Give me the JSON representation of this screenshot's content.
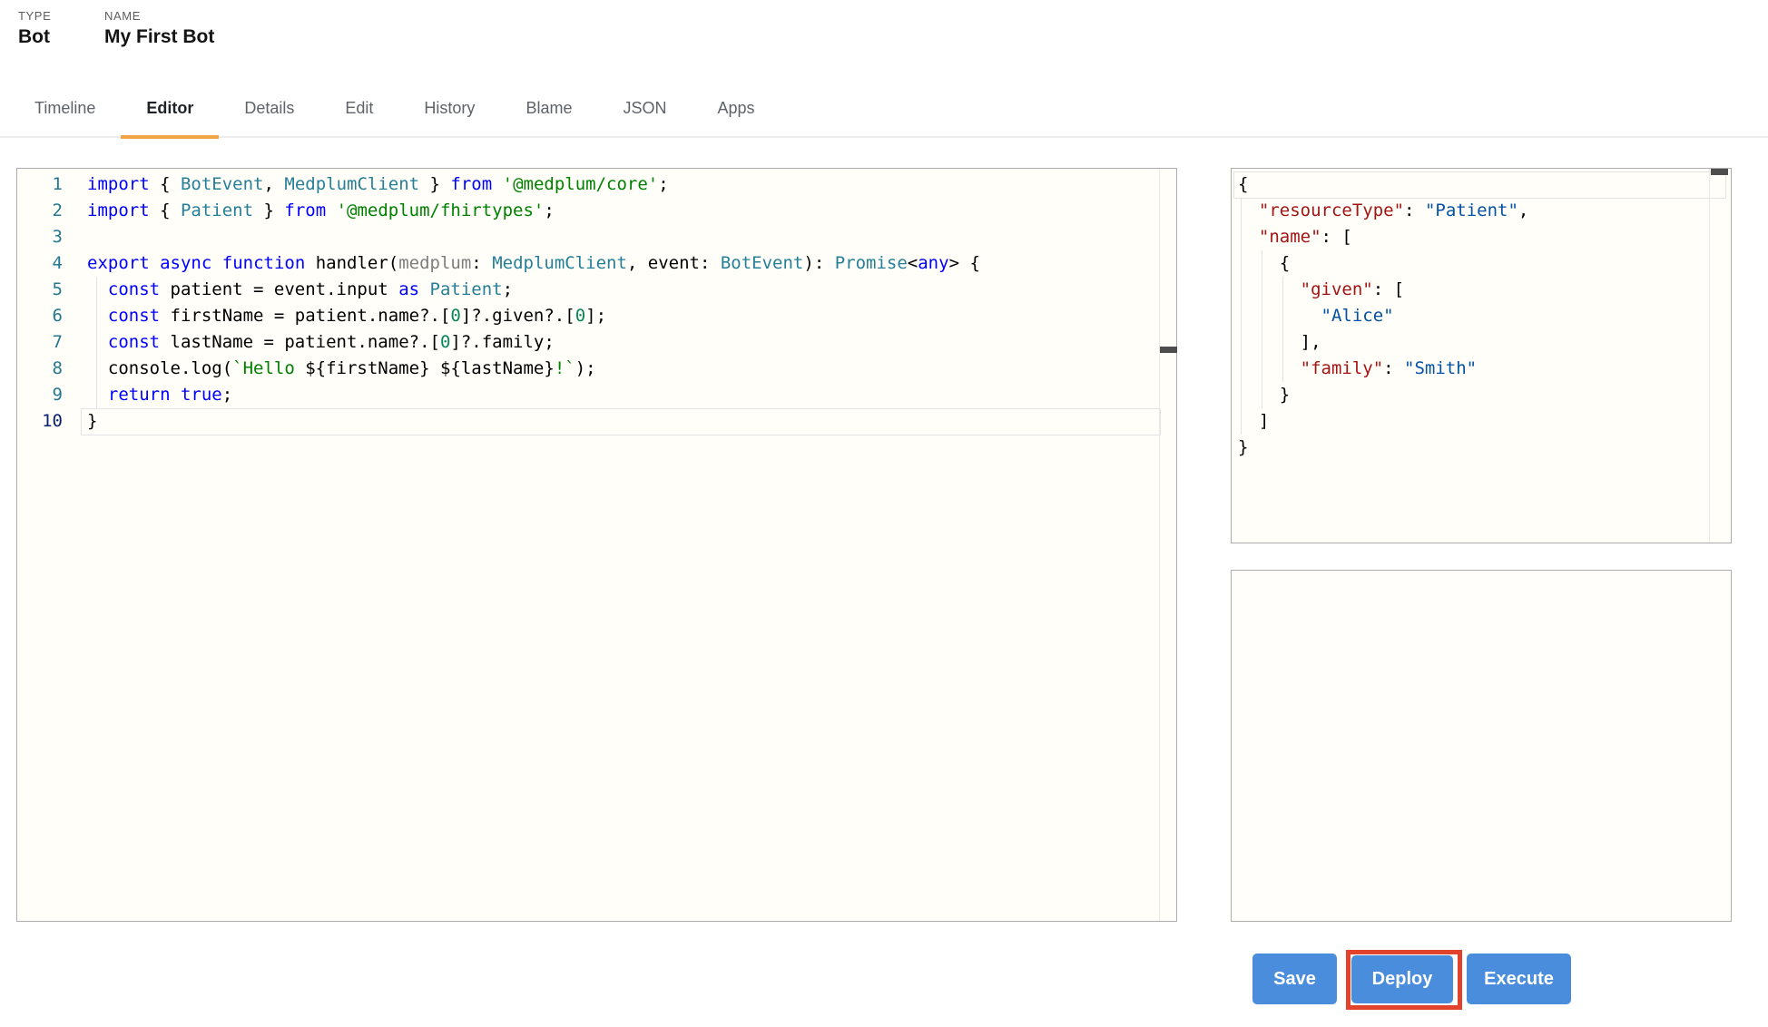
{
  "header": {
    "type_label": "TYPE",
    "type_value": "Bot",
    "name_label": "NAME",
    "name_value": "My First Bot"
  },
  "tabs": {
    "items": [
      "Timeline",
      "Editor",
      "Details",
      "Edit",
      "History",
      "Blame",
      "JSON",
      "Apps"
    ],
    "active": "Editor"
  },
  "colors": {
    "accent_orange": "#f2a444",
    "button_blue": "#4a8ddd",
    "annotation_red": "#e2432c",
    "line_number": "#237893",
    "active_line_number": "#0b216f",
    "panel_border": "#adadad"
  },
  "code_editor": {
    "active_line": 10,
    "lines": [
      {
        "num": 1,
        "tokens": [
          {
            "c": "kw",
            "t": "import"
          },
          {
            "c": "pl",
            "t": " { "
          },
          {
            "c": "ty",
            "t": "BotEvent"
          },
          {
            "c": "pl",
            "t": ", "
          },
          {
            "c": "ty",
            "t": "MedplumClient"
          },
          {
            "c": "pl",
            "t": " } "
          },
          {
            "c": "kw",
            "t": "from"
          },
          {
            "c": "pl",
            "t": " "
          },
          {
            "c": "st",
            "t": "'@medplum/core'"
          },
          {
            "c": "pl",
            "t": ";"
          }
        ]
      },
      {
        "num": 2,
        "tokens": [
          {
            "c": "kw",
            "t": "import"
          },
          {
            "c": "pl",
            "t": " { "
          },
          {
            "c": "ty",
            "t": "Patient"
          },
          {
            "c": "pl",
            "t": " } "
          },
          {
            "c": "kw",
            "t": "from"
          },
          {
            "c": "pl",
            "t": " "
          },
          {
            "c": "st",
            "t": "'@medplum/fhirtypes'"
          },
          {
            "c": "pl",
            "t": ";"
          }
        ]
      },
      {
        "num": 3,
        "tokens": []
      },
      {
        "num": 4,
        "tokens": [
          {
            "c": "kw",
            "t": "export"
          },
          {
            "c": "pl",
            "t": " "
          },
          {
            "c": "kw",
            "t": "async"
          },
          {
            "c": "pl",
            "t": " "
          },
          {
            "c": "kw",
            "t": "function"
          },
          {
            "c": "pl",
            "t": " handler("
          },
          {
            "c": "dim",
            "t": "medplum"
          },
          {
            "c": "pl",
            "t": ": "
          },
          {
            "c": "ty",
            "t": "MedplumClient"
          },
          {
            "c": "pl",
            "t": ", event: "
          },
          {
            "c": "ty",
            "t": "BotEvent"
          },
          {
            "c": "pl",
            "t": "): "
          },
          {
            "c": "ty",
            "t": "Promise"
          },
          {
            "c": "pl",
            "t": "<"
          },
          {
            "c": "kw",
            "t": "any"
          },
          {
            "c": "pl",
            "t": "> {"
          }
        ]
      },
      {
        "num": 5,
        "tokens": [
          {
            "c": "pl",
            "t": "  "
          },
          {
            "c": "kw",
            "t": "const"
          },
          {
            "c": "pl",
            "t": " patient = event.input "
          },
          {
            "c": "kw",
            "t": "as"
          },
          {
            "c": "pl",
            "t": " "
          },
          {
            "c": "ty",
            "t": "Patient"
          },
          {
            "c": "pl",
            "t": ";"
          }
        ]
      },
      {
        "num": 6,
        "tokens": [
          {
            "c": "pl",
            "t": "  "
          },
          {
            "c": "kw",
            "t": "const"
          },
          {
            "c": "pl",
            "t": " firstName = patient.name?.["
          },
          {
            "c": "nu",
            "t": "0"
          },
          {
            "c": "pl",
            "t": "]?.given?.["
          },
          {
            "c": "nu",
            "t": "0"
          },
          {
            "c": "pl",
            "t": "];"
          }
        ]
      },
      {
        "num": 7,
        "tokens": [
          {
            "c": "pl",
            "t": "  "
          },
          {
            "c": "kw",
            "t": "const"
          },
          {
            "c": "pl",
            "t": " lastName = patient.name?.["
          },
          {
            "c": "nu",
            "t": "0"
          },
          {
            "c": "pl",
            "t": "]?.family;"
          }
        ]
      },
      {
        "num": 8,
        "tokens": [
          {
            "c": "pl",
            "t": "  console.log("
          },
          {
            "c": "st",
            "t": "`Hello "
          },
          {
            "c": "pl",
            "t": "${firstName}"
          },
          {
            "c": "st",
            "t": " "
          },
          {
            "c": "pl",
            "t": "${lastName}"
          },
          {
            "c": "st",
            "t": "!`"
          },
          {
            "c": "pl",
            "t": ");"
          }
        ]
      },
      {
        "num": 9,
        "tokens": [
          {
            "c": "pl",
            "t": "  "
          },
          {
            "c": "kw",
            "t": "return"
          },
          {
            "c": "pl",
            "t": " "
          },
          {
            "c": "kw",
            "t": "true"
          },
          {
            "c": "pl",
            "t": ";"
          }
        ]
      },
      {
        "num": 10,
        "tokens": [
          {
            "c": "pl",
            "t": "}"
          }
        ]
      }
    ]
  },
  "input_editor": {
    "active_line": 1,
    "lines": [
      {
        "tokens": [
          {
            "c": "jp",
            "t": "{"
          }
        ]
      },
      {
        "tokens": [
          {
            "c": "jp",
            "t": "  "
          },
          {
            "c": "jk",
            "t": "\"resourceType\""
          },
          {
            "c": "jp",
            "t": ": "
          },
          {
            "c": "js",
            "t": "\"Patient\""
          },
          {
            "c": "jp",
            "t": ","
          }
        ]
      },
      {
        "tokens": [
          {
            "c": "jp",
            "t": "  "
          },
          {
            "c": "jk",
            "t": "\"name\""
          },
          {
            "c": "jp",
            "t": ": ["
          }
        ]
      },
      {
        "tokens": [
          {
            "c": "jp",
            "t": "    {"
          }
        ]
      },
      {
        "tokens": [
          {
            "c": "jp",
            "t": "      "
          },
          {
            "c": "jk",
            "t": "\"given\""
          },
          {
            "c": "jp",
            "t": ": ["
          }
        ]
      },
      {
        "tokens": [
          {
            "c": "jp",
            "t": "        "
          },
          {
            "c": "js",
            "t": "\"Alice\""
          }
        ]
      },
      {
        "tokens": [
          {
            "c": "jp",
            "t": "      ],"
          }
        ]
      },
      {
        "tokens": [
          {
            "c": "jp",
            "t": "      "
          },
          {
            "c": "jk",
            "t": "\"family\""
          },
          {
            "c": "jp",
            "t": ": "
          },
          {
            "c": "js",
            "t": "\"Smith\""
          }
        ]
      },
      {
        "tokens": [
          {
            "c": "jp",
            "t": "    }"
          }
        ]
      },
      {
        "tokens": [
          {
            "c": "jp",
            "t": "  ]"
          }
        ]
      },
      {
        "tokens": [
          {
            "c": "jp",
            "t": "}"
          }
        ]
      }
    ]
  },
  "actions": {
    "save_label": "Save",
    "deploy_label": "Deploy",
    "execute_label": "Execute"
  }
}
